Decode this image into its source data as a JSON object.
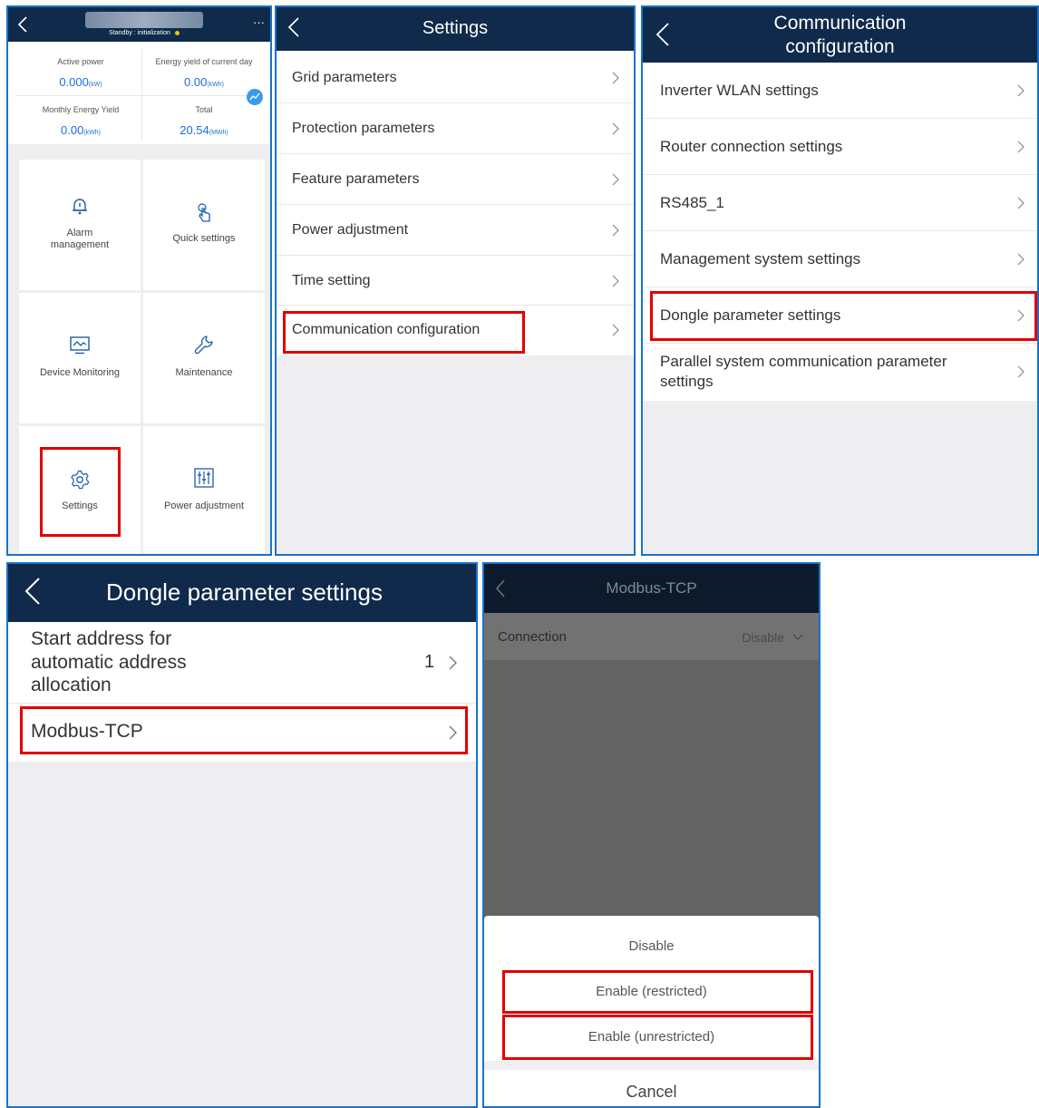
{
  "colors": {
    "accent": "#1a73c8",
    "navbar": "#0f2a4a",
    "highlight": "#e00000",
    "value_blue": "#1a6fd8"
  },
  "home": {
    "status": "Standby : initialization",
    "status_dot_color": "#f4c20d",
    "more_label": "···",
    "stats": [
      {
        "label": "Active power",
        "value": "0.000",
        "unit": "(kW)"
      },
      {
        "label": "Energy yield of current day",
        "value": "0.00",
        "unit": "(kWh)"
      },
      {
        "label": "Monthly Energy Yield",
        "value": "0.00",
        "unit": "(kWh)"
      },
      {
        "label": "Total",
        "value": "20.54",
        "unit": "(MWh)"
      }
    ],
    "tiles": [
      {
        "label": "Alarm management",
        "icon": "bell-icon"
      },
      {
        "label": "Quick settings",
        "icon": "tap-hand-icon"
      },
      {
        "label": "Device Monitoring",
        "icon": "monitor-icon"
      },
      {
        "label": "Maintenance",
        "icon": "wrench-icon"
      },
      {
        "label": "Settings",
        "icon": "gear-icon"
      },
      {
        "label": "Power adjustment",
        "icon": "sliders-icon"
      }
    ]
  },
  "settings": {
    "title": "Settings",
    "items": [
      "Grid parameters",
      "Protection parameters",
      "Feature parameters",
      "Power adjustment",
      "Time setting",
      "Communication configuration"
    ]
  },
  "comm": {
    "title_line1": "Communication",
    "title_line2": "configuration",
    "items": [
      "Inverter WLAN settings",
      "Router connection settings",
      "RS485_1",
      "Management system settings",
      "Dongle parameter settings"
    ],
    "item_last_line1": "Parallel system communication parameter",
    "item_last_line2": "settings"
  },
  "dongle": {
    "title": "Dongle parameter settings",
    "start_line1": "Start address for",
    "start_line2": "automatic address",
    "start_line3": "allocation",
    "start_value": "1",
    "modbus": "Modbus-TCP"
  },
  "modbus": {
    "title": "Modbus-TCP",
    "connection_label": "Connection",
    "connection_value": "Disable",
    "options": [
      "Disable",
      "Enable (restricted)",
      "Enable (unrestricted)"
    ],
    "cancel": "Cancel"
  }
}
